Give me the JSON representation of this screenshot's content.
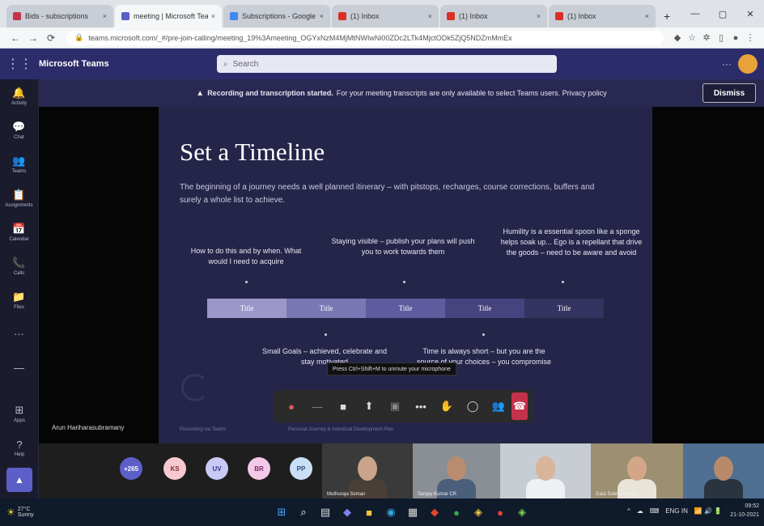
{
  "browser": {
    "tabs": [
      {
        "label": "Bids - subscriptions",
        "color": "#c4314b",
        "active": false
      },
      {
        "label": "meeting | Microsoft Teams",
        "color": "#5b5fc7",
        "active": true
      },
      {
        "label": "Subscriptions - Google",
        "color": "#4285f4",
        "active": false
      },
      {
        "label": "(1) Inbox",
        "color": "#d93025",
        "active": false
      },
      {
        "label": "(1) Inbox",
        "color": "#d93025",
        "active": false
      },
      {
        "label": "(1) Inbox",
        "color": "#d93025",
        "active": false
      }
    ],
    "new_tab": "+",
    "url": "teams.microsoft.com/_#/pre-join-calling/meeting_19%3Ameeting_OGYxNzM4MjMtNWIwNi00ZDc2LTk4MjctODk5ZjQ5NDZmMmEx",
    "icons": {
      "back": "back-arrow",
      "forward": "forward-arrow",
      "reload": "reload-icon",
      "lock": "lock-icon"
    },
    "win_controls": [
      "—",
      "▢",
      "✕"
    ]
  },
  "teams": {
    "app_name": "Microsoft Teams",
    "search_placeholder": "Search",
    "more": "···",
    "rail": [
      {
        "icon": "🔔",
        "label": "Activity"
      },
      {
        "icon": "💬",
        "label": "Chat"
      },
      {
        "icon": "👥",
        "label": "Teams"
      },
      {
        "icon": "📋",
        "label": "Assignments"
      },
      {
        "icon": "📅",
        "label": "Calendar"
      },
      {
        "icon": "📞",
        "label": "Calls"
      },
      {
        "icon": "📁",
        "label": "Files"
      },
      {
        "icon": "···",
        "label": ""
      },
      {
        "icon": "—",
        "label": ""
      }
    ],
    "rail_bottom": [
      {
        "icon": "⊞",
        "label": "Apps"
      },
      {
        "icon": "?",
        "label": "Help"
      }
    ],
    "rail_button_icon": "▲"
  },
  "banner": {
    "icon": "▲",
    "bold_text": "Recording and transcription started.",
    "text": "For your meeting transcripts are only available to select Teams users. Privacy policy",
    "dismiss_label": "Dismiss"
  },
  "slide": {
    "title": "Set a Timeline",
    "intro": "The beginning of a journey needs a well planned itinerary – with pitstops, recharges, course corrections, buffers and surely a whole list to achieve.",
    "notes_top": [
      "How to do this and by when. What would I need to acquire",
      "Staying visible – publish your plans will push you to work towards them",
      "Humility is a essential spoon like a sponge helps soak up... Ego is a repellant that drive the goods – need to be aware and avoid"
    ],
    "timeline": [
      {
        "label": "Title",
        "color": "#9b98c9"
      },
      {
        "label": "Title",
        "color": "#7a77b5"
      },
      {
        "label": "Title",
        "color": "#5e5b9e"
      },
      {
        "label": "Title",
        "color": "#46437f"
      },
      {
        "label": "Title",
        "color": "#35335f"
      }
    ],
    "notes_bottom": [
      "Small Goals – achieved, celebrate and stay motivated",
      "Time is always short – but you are the source of your choices – you compromise"
    ],
    "footer_left": "Presenting via Teams",
    "footer_mid": "Personal Journey & Individual Development Plan"
  },
  "presenter_name": "Arun Hariharasubramany",
  "tooltip": "Press Ctrl+Shift+M to unmute your microphone",
  "controls": [
    {
      "name": "mic-icon",
      "glyph": "●",
      "off": false,
      "color": "#e05a5a"
    },
    {
      "name": "divider-icon",
      "glyph": "—",
      "off": true,
      "color": ""
    },
    {
      "name": "camera-icon",
      "glyph": "■",
      "off": false,
      "color": ""
    },
    {
      "name": "share-icon",
      "glyph": "⬆",
      "off": false,
      "color": ""
    },
    {
      "name": "screen-icon",
      "glyph": "▣",
      "off": true,
      "color": ""
    },
    {
      "name": "more-icon",
      "glyph": "•••",
      "off": false,
      "color": ""
    },
    {
      "name": "raise-hand-icon",
      "glyph": "✋",
      "off": false,
      "color": ""
    },
    {
      "name": "chat-icon",
      "glyph": "◯",
      "off": false,
      "color": ""
    },
    {
      "name": "people-icon",
      "glyph": "👥",
      "off": false,
      "color": ""
    }
  ],
  "leave_icon": "☎",
  "participants": {
    "overflow": {
      "label": "+265",
      "color": "#5b5fc7"
    },
    "avatars": [
      {
        "initials": "KS",
        "color": "#f5c9cf",
        "text": "#8a2a3a"
      },
      {
        "initials": "UV",
        "color": "#c9c9f5",
        "text": "#3a3a8a"
      },
      {
        "initials": "BR",
        "color": "#f2c9e8",
        "text": "#7a2a62"
      },
      {
        "initials": "PP",
        "color": "#c9dff5",
        "text": "#2a4d7a"
      }
    ],
    "videos": [
      {
        "label": "Muthuraja Soman",
        "bg": "#3a3a3a",
        "skin": "#c9a48a",
        "shirt": "#4a3f36"
      },
      {
        "label": "Sanjay Kumar CR",
        "bg": "#8a8f96",
        "skin": "#b98c6f",
        "shirt": "#4a5f7a"
      },
      {
        "label": "",
        "bg": "#c7cdd2",
        "skin": "#d8b498",
        "shirt": "#eef1f3"
      },
      {
        "label": "Gaia Subramaniam",
        "bg": "#9c8f72",
        "skin": "#d4a688",
        "shirt": "#e9e4d8"
      },
      {
        "label": "",
        "bg": "#4f6f93",
        "skin": "#b88a6c",
        "shirt": "#2a3440"
      }
    ]
  },
  "taskbar": {
    "weather_icon": "☀",
    "weather_temp": "27°C",
    "weather_text": "Sunny",
    "apps": [
      {
        "name": "start-icon",
        "glyph": "⊞",
        "color": "#4aa3ff"
      },
      {
        "name": "search-icon",
        "glyph": "⌕",
        "color": "#ffffff"
      },
      {
        "name": "task-view-icon",
        "glyph": "▤",
        "color": "#dddddd"
      },
      {
        "name": "teams-icon",
        "glyph": "◆",
        "color": "#7b83eb"
      },
      {
        "name": "file-explorer-icon",
        "glyph": "■",
        "color": "#f4c542"
      },
      {
        "name": "edge-icon",
        "glyph": "◉",
        "color": "#2fa9e0"
      },
      {
        "name": "store-icon",
        "glyph": "▦",
        "color": "#dddddd"
      },
      {
        "name": "office-icon",
        "glyph": "◆",
        "color": "#e0452c"
      },
      {
        "name": "chrome-icon",
        "glyph": "●",
        "color": "#34a853"
      },
      {
        "name": "app-icon",
        "glyph": "◈",
        "color": "#f4c542"
      },
      {
        "name": "chrome-alt-icon",
        "glyph": "●",
        "color": "#ea4335"
      },
      {
        "name": "app-alt-icon",
        "glyph": "◈",
        "color": "#7bd14b"
      }
    ],
    "tray": [
      "^",
      "☁",
      "⌨",
      "ENG IN",
      "📶 🔊 🔋"
    ],
    "time": "09:52",
    "date": "21-10-2021"
  }
}
